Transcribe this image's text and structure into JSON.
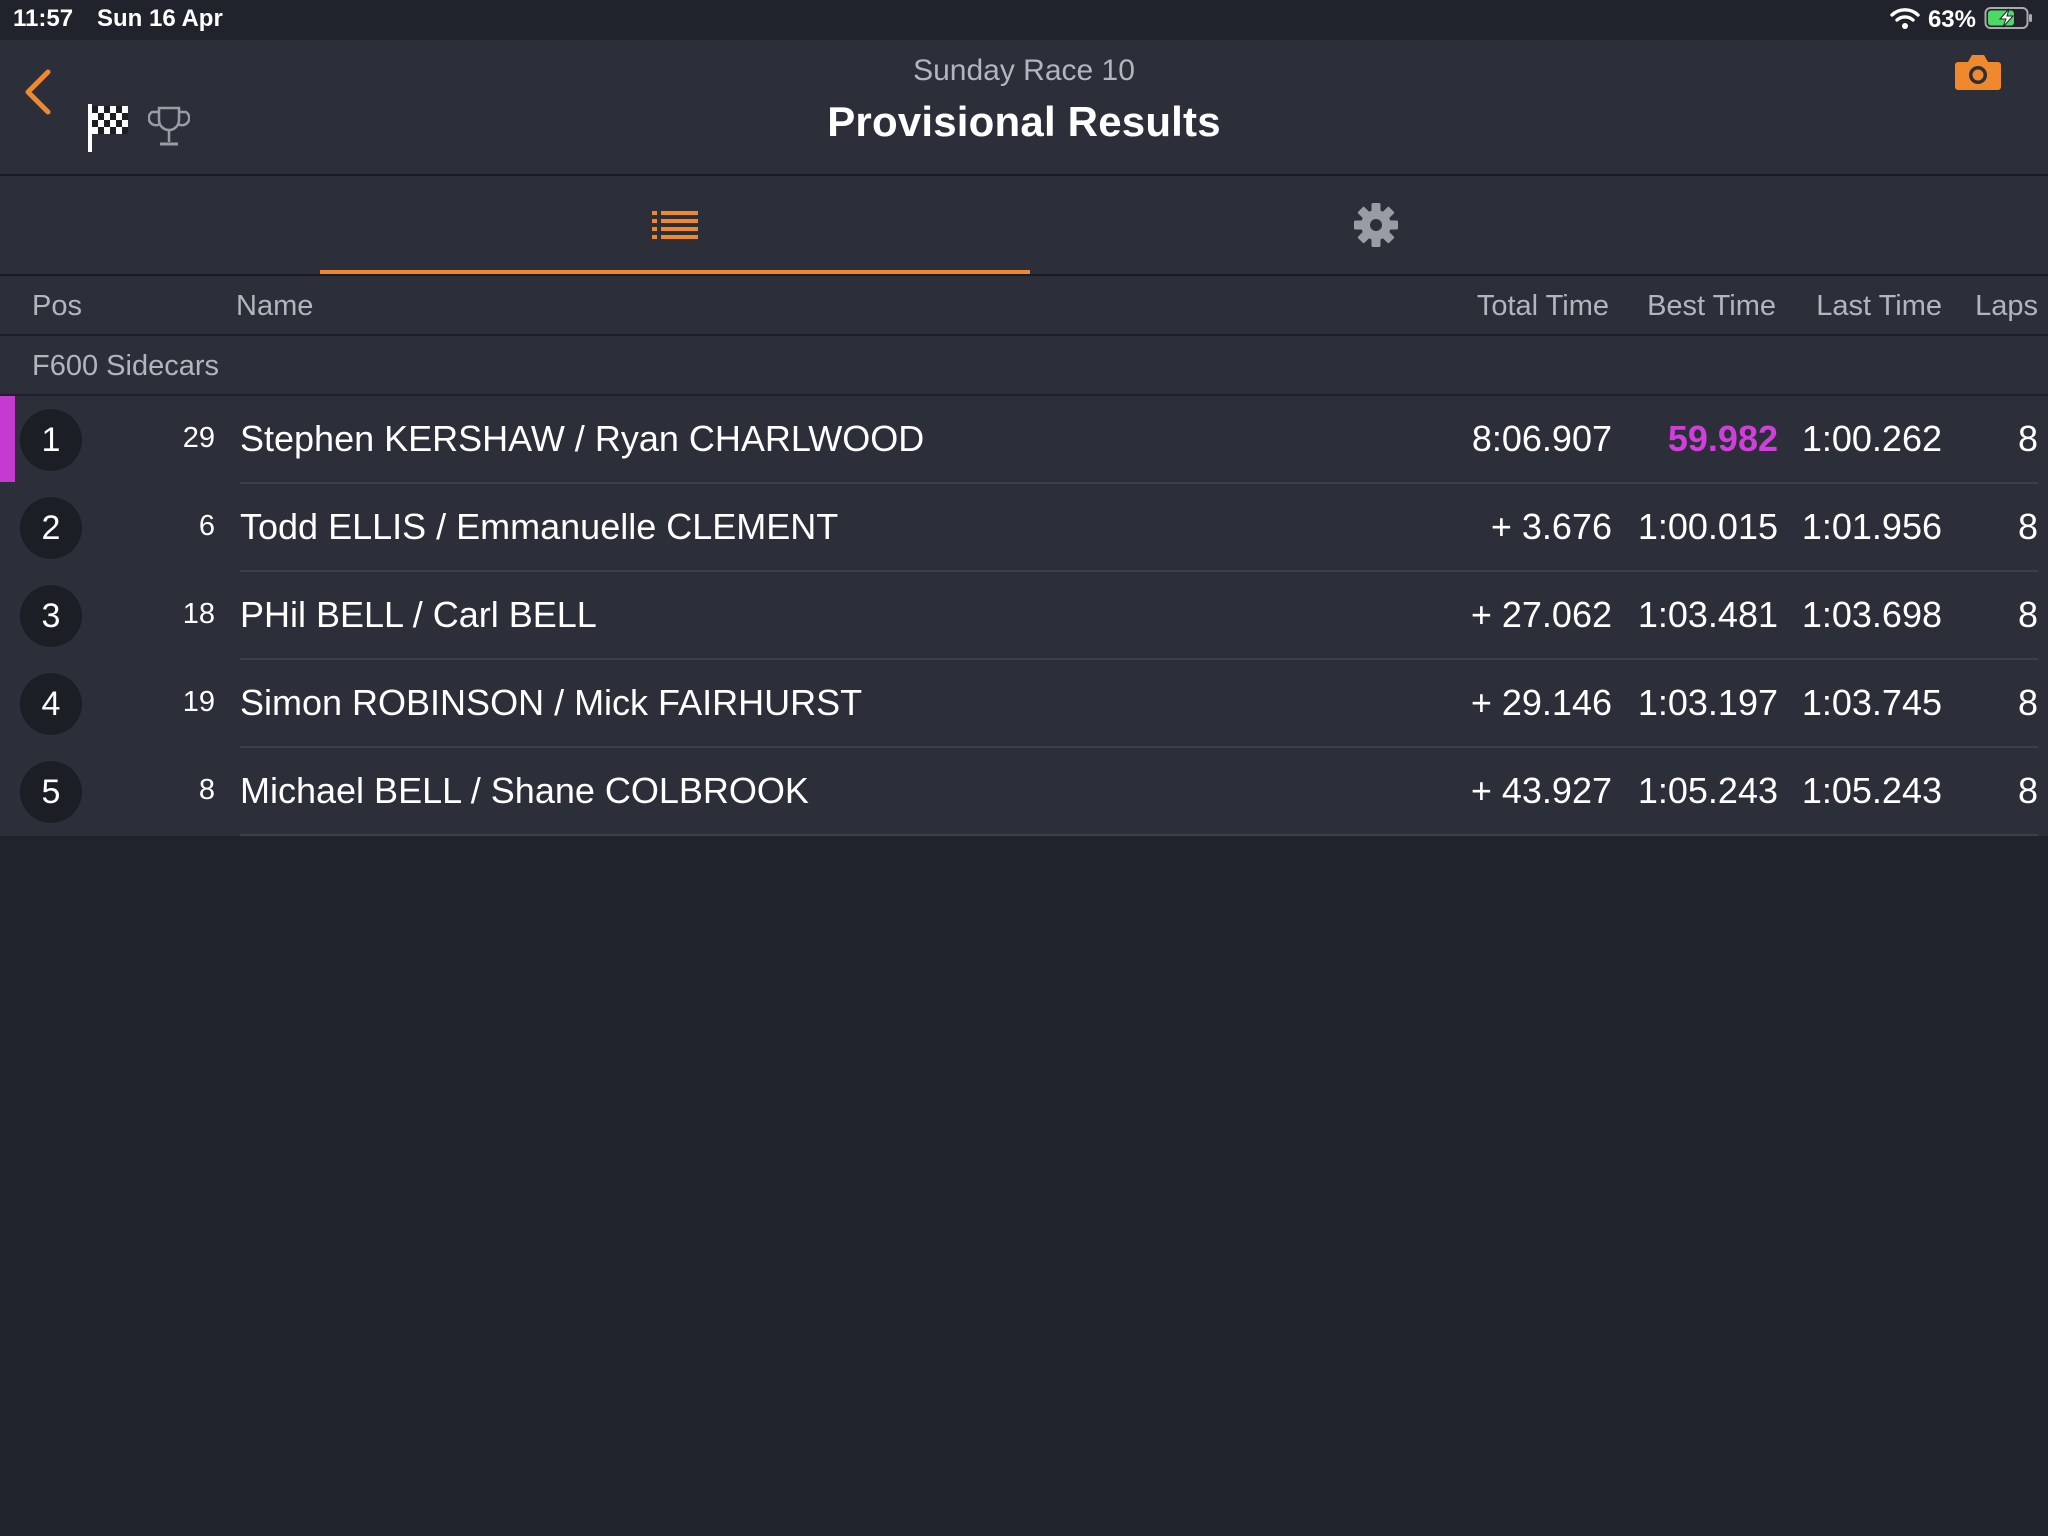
{
  "status_bar": {
    "time": "11:57",
    "date": "Sun 16 Apr",
    "battery": "63%",
    "icons": [
      "wifi-icon",
      "battery-charging-icon"
    ]
  },
  "header": {
    "subtitle": "Sunday Race 10",
    "title": "Provisional Results",
    "icons": [
      "back-chevron-icon",
      "checkered-flag-icon",
      "trophy-icon",
      "camera-icon"
    ],
    "accent_color": "#f0892e"
  },
  "tabs": [
    {
      "icon": "list-icon",
      "selected": true
    },
    {
      "icon": "gear-icon",
      "selected": false
    }
  ],
  "columns": {
    "pos": "Pos",
    "name": "Name",
    "total_time": "Total Time",
    "best_time": "Best Time",
    "last_time": "Last Time",
    "laps": "Laps"
  },
  "group": {
    "label": "F600 Sidecars"
  },
  "fastest_lap_color": "#d23edb",
  "rows": [
    {
      "pos": "1",
      "number": "29",
      "name": "Stephen KERSHAW / Ryan CHARLWOOD",
      "total": "8:06.907",
      "best": "59.982",
      "last": "1:00.262",
      "laps": "8"
    },
    {
      "pos": "2",
      "number": "6",
      "name": "Todd ELLIS / Emmanuelle CLEMENT",
      "total": "+ 3.676",
      "best": "1:00.015",
      "last": "1:01.956",
      "laps": "8"
    },
    {
      "pos": "3",
      "number": "18",
      "name": "PHil BELL / Carl BELL",
      "total": "+ 27.062",
      "best": "1:03.481",
      "last": "1:03.698",
      "laps": "8"
    },
    {
      "pos": "4",
      "number": "19",
      "name": "Simon ROBINSON / Mick FAIRHURST",
      "total": "+ 29.146",
      "best": "1:03.197",
      "last": "1:03.745",
      "laps": "8"
    },
    {
      "pos": "5",
      "number": "8",
      "name": "Michael BELL / Shane COLBROOK",
      "total": "+ 43.927",
      "best": "1:05.243",
      "last": "1:05.243",
      "laps": "8"
    }
  ]
}
